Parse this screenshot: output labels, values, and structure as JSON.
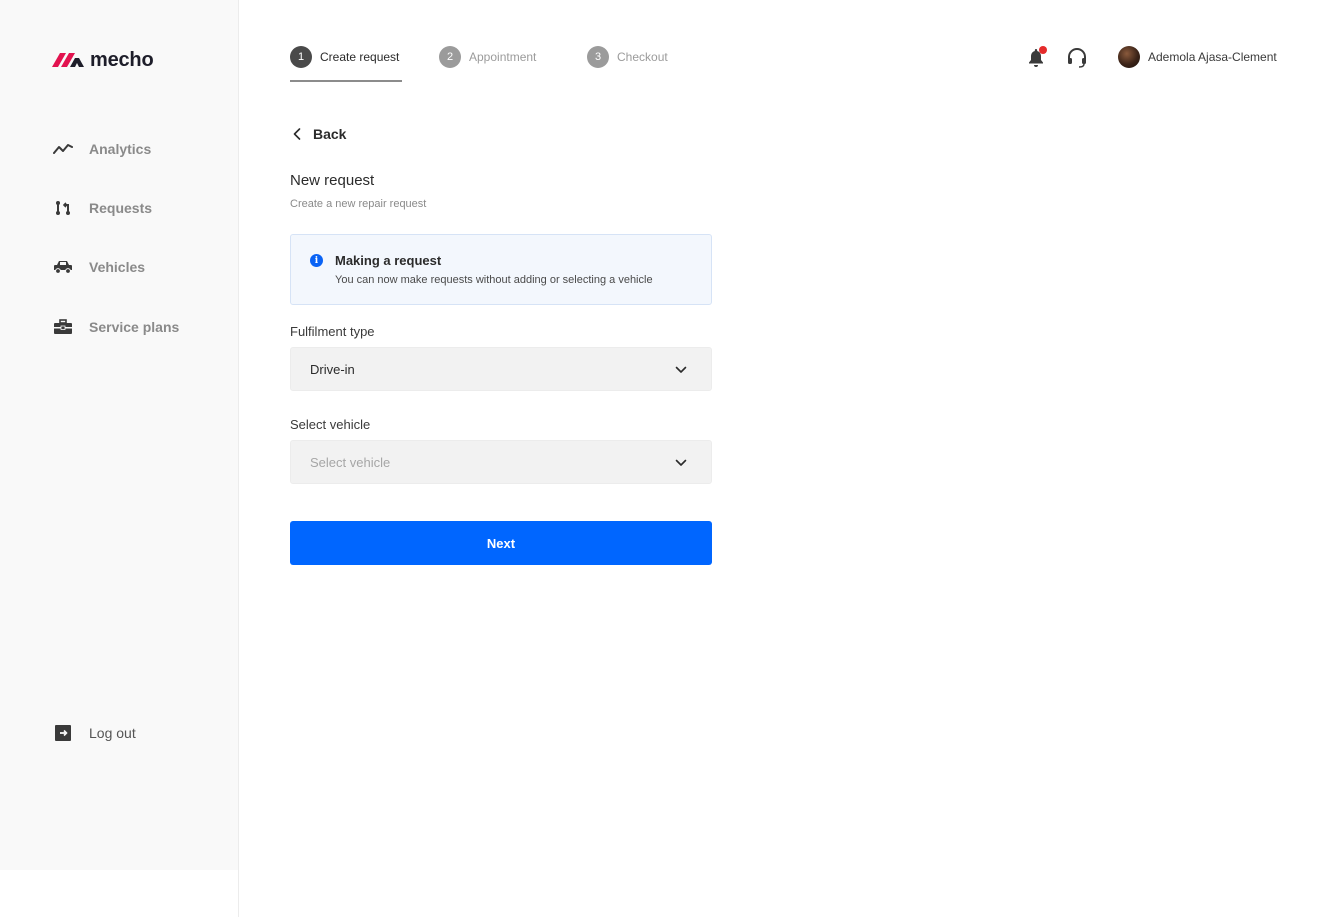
{
  "brand": {
    "name": "mecho",
    "colors": {
      "logo_red": "#e2134f",
      "logo_dark": "#1e1e2a",
      "primary": "#0066ff",
      "notification": "#e52b2b"
    }
  },
  "sidebar": {
    "items": [
      {
        "label": "Analytics",
        "icon": "analytics-icon"
      },
      {
        "label": "Requests",
        "icon": "requests-icon"
      },
      {
        "label": "Vehicles",
        "icon": "car-icon"
      },
      {
        "label": "Service plans",
        "icon": "toolbox-icon"
      }
    ],
    "logout": {
      "label": "Log out",
      "icon": "logout-icon"
    }
  },
  "stepper": {
    "steps": [
      {
        "number": "1",
        "label": "Create request",
        "active": true
      },
      {
        "number": "2",
        "label": "Appointment",
        "active": false
      },
      {
        "number": "3",
        "label": "Checkout",
        "active": false
      }
    ]
  },
  "header": {
    "user_name": "Ademola Ajasa-Clement",
    "icons": [
      "bell-icon",
      "headset-icon",
      "avatar"
    ]
  },
  "main": {
    "back_label": "Back",
    "title": "New request",
    "subtitle": "Create a new repair request",
    "notice": {
      "title": "Making a request",
      "text": "You can now make requests without adding or selecting a vehicle",
      "icon_glyph": "i"
    },
    "fulfilment": {
      "label": "Fulfilment type",
      "value": "Drive-in"
    },
    "vehicle": {
      "label": "Select vehicle",
      "placeholder": "Select vehicle"
    },
    "next_label": "Next"
  }
}
